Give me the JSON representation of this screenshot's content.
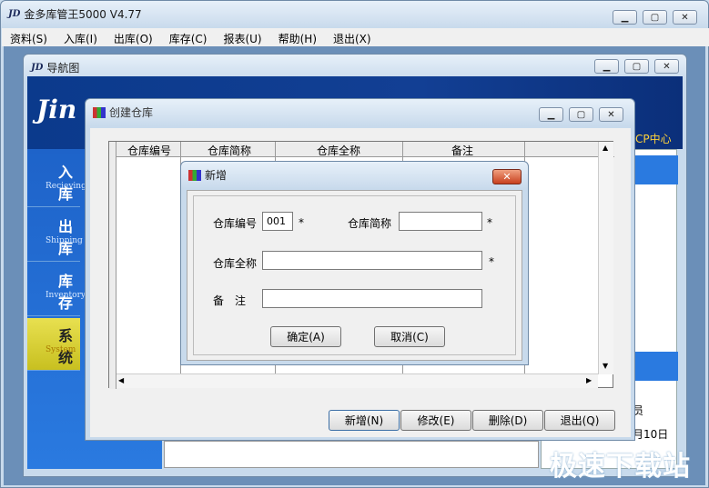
{
  "main_window": {
    "logo": "JD",
    "title": "金多库管王5000 V4.77",
    "menus": [
      "资料(S)",
      "入库(I)",
      "出库(O)",
      "库存(C)",
      "报表(U)",
      "帮助(H)",
      "退出(X)"
    ]
  },
  "nav_window": {
    "logo": "JD",
    "title": "导航图",
    "banner_text": "Jin",
    "right_label": "CP中心",
    "items": [
      {
        "cn": "入库",
        "en": "Recieving"
      },
      {
        "cn": "出库",
        "en": "Shipping"
      },
      {
        "cn": "库存",
        "en": "Inventory"
      },
      {
        "cn": "系统",
        "en": "System"
      }
    ],
    "right_text_1": "员",
    "right_text_2": "月10日"
  },
  "warehouse_window": {
    "title": "创建仓库",
    "columns": [
      "仓库编号",
      "仓库简称",
      "仓库全称",
      "备注"
    ],
    "buttons": [
      "新增(N)",
      "修改(E)",
      "删除(D)",
      "退出(Q)"
    ]
  },
  "add_dialog": {
    "title": "新增",
    "code_label": "仓库编号",
    "code_value": "001",
    "short_label": "仓库简称",
    "short_value": "",
    "full_label": "仓库全称",
    "full_value": "",
    "note_label": "备　注",
    "note_value": "",
    "required_mark": "*",
    "ok_label": "确定(A)",
    "cancel_label": "取消(C)"
  },
  "watermark": "极速下载站"
}
